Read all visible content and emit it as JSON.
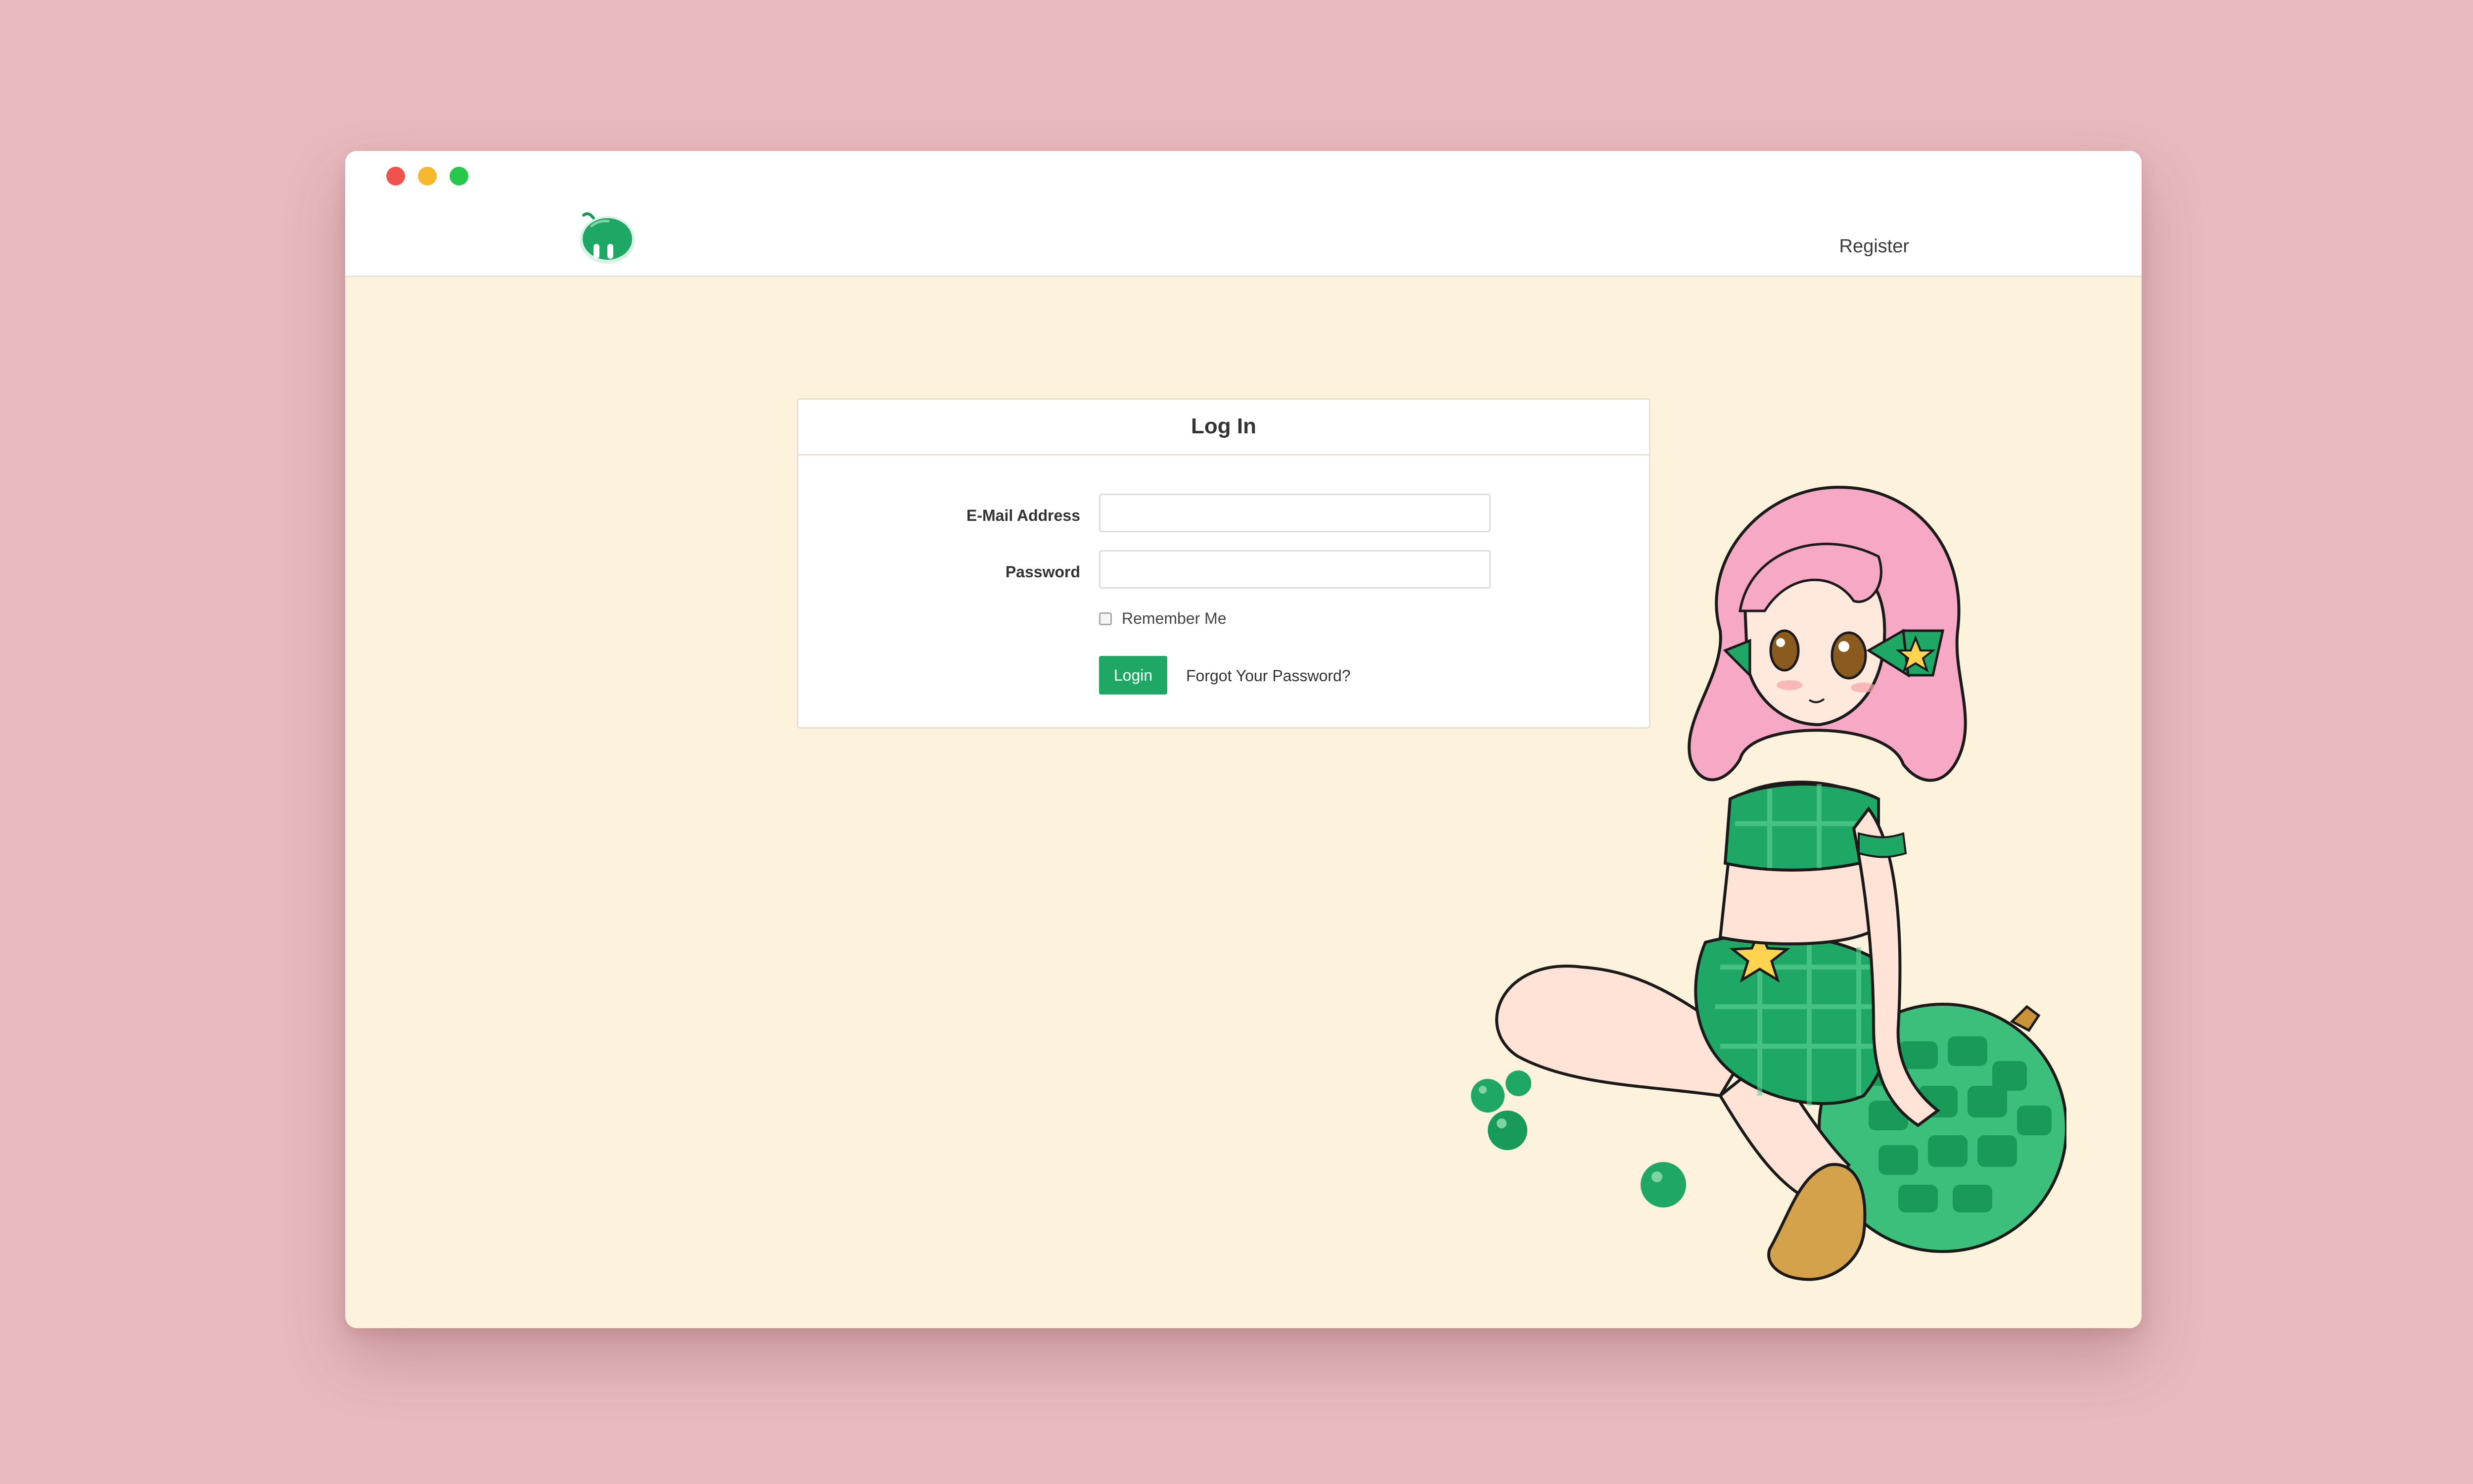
{
  "colors": {
    "page_background": "#e8b9bd",
    "content_background": "#fdf2dc",
    "accent": "#1fa865",
    "window_close": "#ef5350",
    "window_minimize": "#f5b82e",
    "window_maximize": "#27c84c"
  },
  "window": {
    "controls": [
      "close",
      "minimize",
      "maximize"
    ]
  },
  "navbar": {
    "logo_icon": "melon-logo-icon",
    "register_label": "Register"
  },
  "login_card": {
    "title": "Log In",
    "email_label": "E-Mail Address",
    "email_value": "",
    "password_label": "Password",
    "password_value": "",
    "remember_label": "Remember Me",
    "remember_checked": false,
    "login_button": "Login",
    "forgot_link": "Forgot Your Password?"
  },
  "illustration": {
    "description_icon": "melon-girl-mascot-illustration"
  }
}
